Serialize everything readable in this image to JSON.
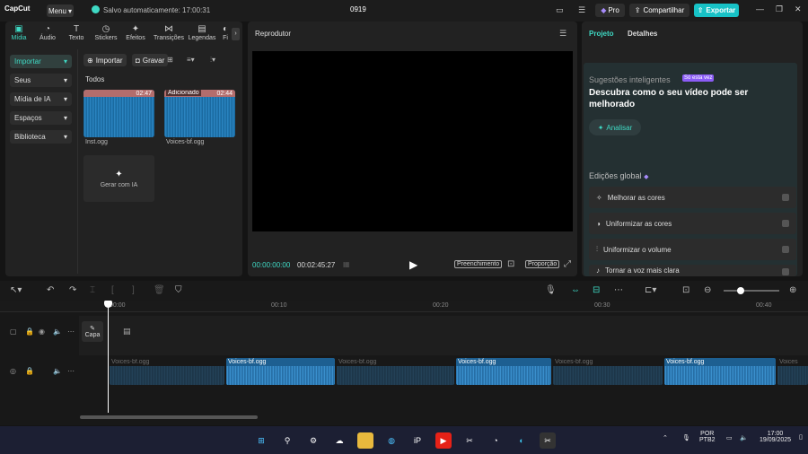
{
  "app": {
    "logo": "CapCut",
    "menu": "Menu",
    "autosave": "Salvo automaticamente: 17:00:31",
    "project": "0919"
  },
  "header": {
    "pro": "Pro",
    "share": "Compartilhar",
    "export": "Exportar"
  },
  "tabs": [
    {
      "label": "Mídia",
      "icon": "media-icon"
    },
    {
      "label": "Áudio",
      "icon": "audio-icon"
    },
    {
      "label": "Texto",
      "icon": "text-icon"
    },
    {
      "label": "Stickers",
      "icon": "sticker-icon"
    },
    {
      "label": "Efeitos",
      "icon": "effects-icon"
    },
    {
      "label": "Transições",
      "icon": "transitions-icon"
    },
    {
      "label": "Legendas",
      "icon": "captions-icon"
    },
    {
      "label": "Fi",
      "icon": "filters-icon"
    }
  ],
  "sidebar": {
    "items": [
      "Importar",
      "Seus",
      "Mídia de IA",
      "Espaços",
      "Biblioteca"
    ]
  },
  "media_toolbar": {
    "import": "Importar",
    "record": "Gravar"
  },
  "media": {
    "filter": "Todos",
    "items": [
      {
        "name": "Inst.ogg",
        "duration": "02:47",
        "tag": ""
      },
      {
        "name": "Voices-bf.ogg",
        "duration": "02:44",
        "tag": "Adicionado"
      }
    ],
    "gen_ai": "Gerar com IA"
  },
  "player": {
    "title": "Reprodutor",
    "current_time": "00:00:00:00",
    "total_time": "00:02:45:27",
    "fill": "Preenchimento",
    "ratio": "Proporção"
  },
  "right_panel": {
    "tabs": [
      "Projeto",
      "Detalhes"
    ],
    "suggestions_title": "Sugestões inteligentes",
    "suggestions_badge": "Só esta vez",
    "discover": "Descubra como o seu vídeo pode ser melhorado",
    "analyze": "Analisar",
    "global_edits": "Edições global",
    "edits": [
      "Melhorar as cores",
      "Uniformizar as cores",
      "Uniformizar o volume",
      "Tornar a voz mais clara"
    ]
  },
  "timeline": {
    "ruler": [
      "00:00",
      "00:10",
      "00:20",
      "00:30",
      "00:40"
    ],
    "cover": "Capa",
    "clips": [
      {
        "name": "Voices-bf.ogg",
        "dim": true
      },
      {
        "name": "Voices-bf.ogg",
        "dim": false
      },
      {
        "name": "Voices-bf.ogg",
        "dim": true
      },
      {
        "name": "Voices-bf.ogg",
        "dim": false
      },
      {
        "name": "Voices-bf.ogg",
        "dim": true
      },
      {
        "name": "Voices-bf.ogg",
        "dim": false
      },
      {
        "name": "Voices",
        "dim": true
      }
    ]
  },
  "taskbar": {
    "lang": "POR",
    "layout": "PTB2",
    "time": "17:00",
    "date": "19/09/2025"
  },
  "colors": {
    "accent": "#3fd9c4",
    "export": "#17c2c6"
  }
}
